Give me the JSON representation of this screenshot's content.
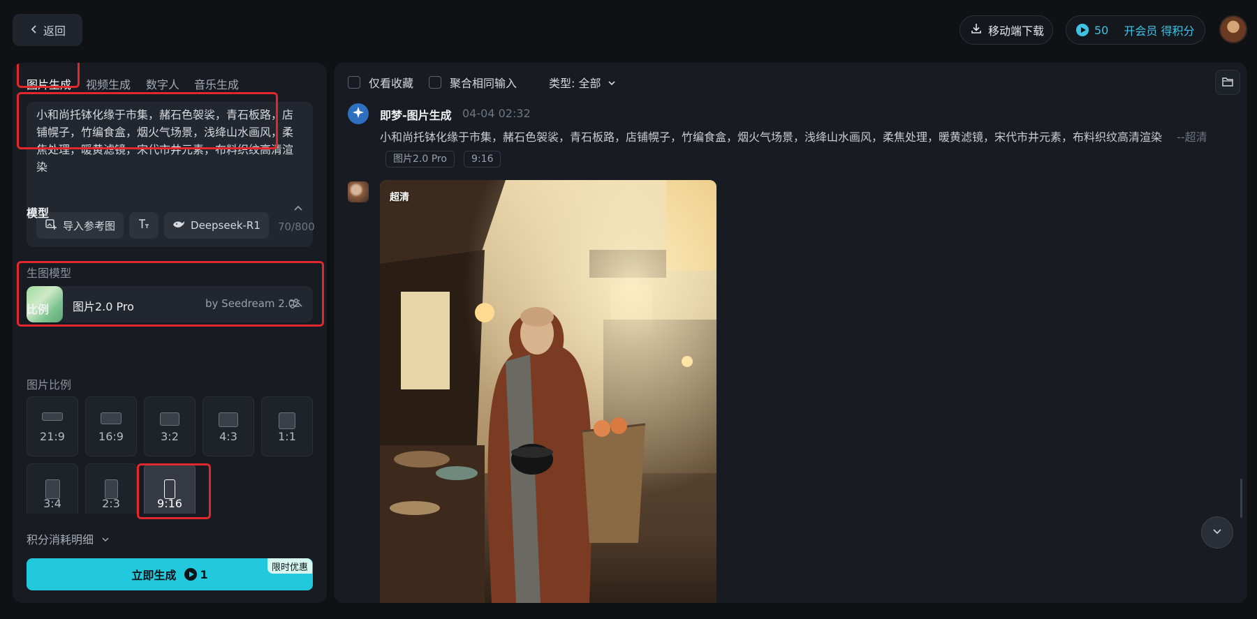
{
  "topbar": {
    "back_label": "返回",
    "download_label": "移动端下载",
    "credits": "50",
    "member_label": "开会员 得积分"
  },
  "left": {
    "tabs": [
      "图片生成",
      "视频生成",
      "数字人",
      "音乐生成"
    ],
    "active_tab": "图片生成",
    "prompt": "小和尚托钵化缘于市集，赭石色袈裟，青石板路，店铺幌子，竹编食盒，烟火气场景，浅绛山水画风，柔焦处理，暖黄滤镜，宋代市井元素，布料织纹高清渲染",
    "tools": {
      "reference_label": "导入参考图",
      "deepseek_label": "Deepseek-R1",
      "counter": "70/800"
    },
    "model_section": {
      "title": "模型",
      "sub_label": "生图模型",
      "model_name": "图片2.0 Pro",
      "model_by": "by Seedream 2.0"
    },
    "ratio_section": {
      "title": "比例",
      "sub_label": "图片比例",
      "options": [
        "21:9",
        "16:9",
        "3:2",
        "4:3",
        "1:1",
        "3:4",
        "2:3",
        "9:16"
      ],
      "selected": "9:16"
    },
    "cost_detail_label": "积分消耗明细",
    "generate": {
      "label": "立即生成",
      "cost": "1",
      "promo": "限时优惠"
    }
  },
  "right": {
    "filters": {
      "favorites_label": "仅看收藏",
      "merge_label": "聚合相同输入",
      "type_label": "类型: 全部"
    },
    "message": {
      "title": "即梦-图片生成",
      "time": "04-04  02:32",
      "prompt": "小和尚托钵化缘于市集，赭石色袈裟，青石板路，店铺幌子，竹编食盒，烟火气场景，浅绛山水画风，柔焦处理，暖黄滤镜，宋代市井元素，布料织纹高清渲染",
      "suffix": "--超清",
      "tags": [
        "图片2.0 Pro",
        "9:16"
      ],
      "image_badge": "超清"
    }
  },
  "colors": {
    "accent": "#22c9dd",
    "highlight": "#e0282d",
    "background": "#0f1115",
    "panel": "#181b21"
  },
  "icons": {
    "back": "chevron-left-icon",
    "download": "download-icon",
    "coin": "credit-coin-icon",
    "reference": "image-add-icon",
    "text": "text-style-icon",
    "deepseek": "whale-icon",
    "settings": "sliders-icon",
    "collapse": "chevron-up-icon",
    "expand": "chevron-down-icon",
    "folder": "folder-icon",
    "bot": "star-sparkle-icon"
  }
}
